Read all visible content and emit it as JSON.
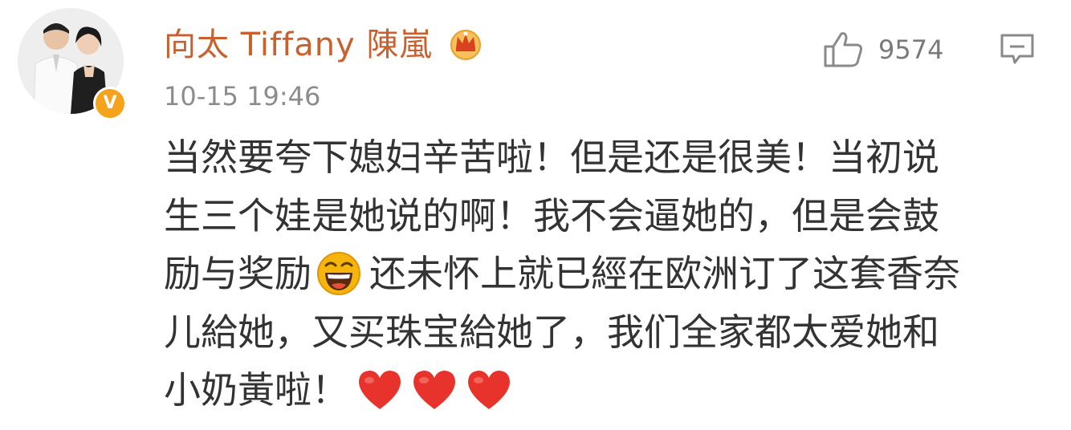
{
  "post": {
    "username": "向太 Tiffany 陳嵐",
    "timestamp": "10-15 19:46",
    "likes": "9574",
    "verified_badge": "V",
    "avatar_icon": "couple-photo-avatar",
    "badge_icon": "crown-icon",
    "colors": {
      "username": "#c9612e",
      "badge": "#f7a21b",
      "timestamp": "#8c8c8c",
      "heart": "#e8322c"
    }
  },
  "comment": {
    "line1": "当然要夸下媳妇辛苦啦！但是还是很美！当初说",
    "line2": "生三个娃是她说的啊！我不会逼她的，但是会鼓",
    "line3_a": "励与奖励",
    "line3_emoji": "laughing-emoji",
    "line3_b": "还未怀上就已經在欧洲订了这套香奈",
    "line4": "儿給她，又买珠宝給她了，我们全家都太爱她和",
    "line5": "小奶黃啦！",
    "hearts": [
      "heart-emoji",
      "heart-emoji",
      "heart-emoji"
    ]
  }
}
